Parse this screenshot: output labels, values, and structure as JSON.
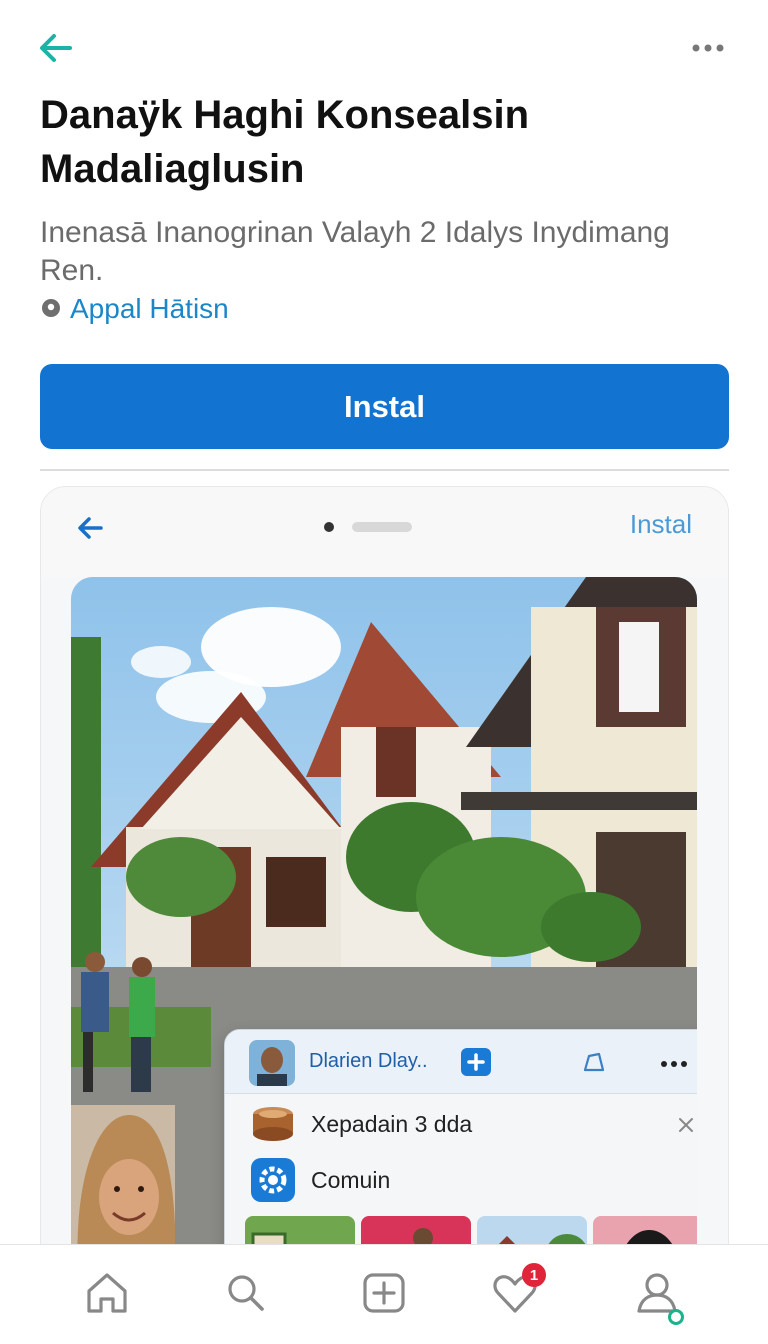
{
  "header": {
    "title": "Danaÿk Haghi Konsealsin Madaliaglusin",
    "subtitle": "Inenasā Inanogrinan Valayh 2  Idalys Inydimang Ren.",
    "developer": "Appal Hātisn"
  },
  "install_label": "Instal",
  "preview": {
    "install_label": "Instal",
    "overlay": {
      "name": "Dlarien Dlay..",
      "row1": "Xepadain 3 dda",
      "row2": "Comuin"
    }
  },
  "nav": {
    "activity_badge": "1"
  },
  "colors": {
    "accent": "#1274d0",
    "back_arrow": "#1ab3a6",
    "link": "#1b86c8",
    "badge": "#e0243a",
    "online": "#1ab38a"
  },
  "icons": [
    "back-arrow-icon",
    "more-icon",
    "location-pin-icon",
    "home-icon",
    "search-icon",
    "add-icon",
    "activity-heart-icon",
    "profile-icon"
  ]
}
